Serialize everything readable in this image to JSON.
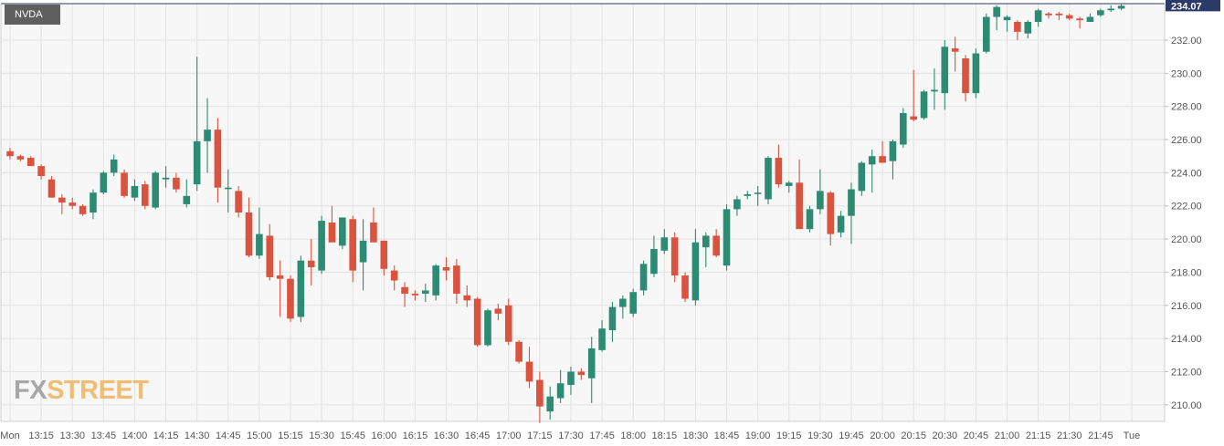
{
  "symbol": "NVDA",
  "watermark": {
    "part1": "FX",
    "part2": "STREET"
  },
  "colors": {
    "up": "#2e8b73",
    "down": "#d9533f",
    "plot_bg": "#f7f7f7",
    "grid": "#e2e2e2",
    "price_tag_bg": "#2b3a66",
    "axis_text": "#555555"
  },
  "chart_data": {
    "type": "candlestick",
    "title": "",
    "ylim": [
      209.0,
      234.2
    ],
    "yticks": [
      210,
      212,
      214,
      216,
      218,
      220,
      222,
      224,
      226,
      228,
      230,
      232
    ],
    "ytick_labels": [
      "210.00",
      "212.00",
      "214.00",
      "216.00",
      "218.00",
      "220.00",
      "222.00",
      "224.00",
      "226.00",
      "228.00",
      "230.00",
      "232.00"
    ],
    "last_price": "234.07",
    "last_price_value": 234.07,
    "x_labels": [
      "Mon",
      "13:15",
      "13:30",
      "13:45",
      "14:00",
      "14:15",
      "14:30",
      "14:45",
      "15:00",
      "15:15",
      "15:30",
      "15:45",
      "16:00",
      "16:15",
      "16:30",
      "16:45",
      "17:00",
      "17:15",
      "17:30",
      "17:45",
      "18:00",
      "18:15",
      "18:30",
      "18:45",
      "19:00",
      "19:15",
      "19:30",
      "19:45",
      "20:00",
      "20:15",
      "20:30",
      "20:45",
      "21:00",
      "21:15",
      "21:30",
      "21:45",
      "Tue"
    ],
    "interval": "5 minutes",
    "candles": [
      {
        "time": "13:00",
        "o": 225.3,
        "h": 225.5,
        "l": 224.8,
        "c": 225.0
      },
      {
        "time": "13:05",
        "o": 225.0,
        "h": 225.1,
        "l": 224.7,
        "c": 224.8
      },
      {
        "time": "13:10",
        "o": 224.9,
        "h": 225.0,
        "l": 224.4,
        "c": 224.4
      },
      {
        "time": "13:15",
        "o": 224.4,
        "h": 224.5,
        "l": 223.6,
        "c": 223.8
      },
      {
        "time": "13:20",
        "o": 223.6,
        "h": 223.8,
        "l": 222.5,
        "c": 222.5
      },
      {
        "time": "13:25",
        "o": 222.5,
        "h": 222.7,
        "l": 221.5,
        "c": 222.2
      },
      {
        "time": "13:30",
        "o": 222.2,
        "h": 222.5,
        "l": 221.8,
        "c": 222.0
      },
      {
        "time": "13:35",
        "o": 222.0,
        "h": 222.1,
        "l": 221.4,
        "c": 221.5
      },
      {
        "time": "13:40",
        "o": 221.6,
        "h": 223.0,
        "l": 221.2,
        "c": 222.8
      },
      {
        "time": "13:45",
        "o": 222.8,
        "h": 224.1,
        "l": 222.7,
        "c": 224.0
      },
      {
        "time": "13:50",
        "o": 224.0,
        "h": 225.1,
        "l": 223.8,
        "c": 224.8
      },
      {
        "time": "13:55",
        "o": 224.0,
        "h": 224.2,
        "l": 222.5,
        "c": 222.6
      },
      {
        "time": "14:00",
        "o": 222.5,
        "h": 223.6,
        "l": 222.3,
        "c": 223.2
      },
      {
        "time": "14:05",
        "o": 223.3,
        "h": 223.5,
        "l": 221.8,
        "c": 222.0
      },
      {
        "time": "14:10",
        "o": 221.9,
        "h": 224.1,
        "l": 221.8,
        "c": 224.0
      },
      {
        "time": "14:15",
        "o": 223.6,
        "h": 224.4,
        "l": 223.1,
        "c": 223.7
      },
      {
        "time": "14:20",
        "o": 223.7,
        "h": 224.0,
        "l": 222.8,
        "c": 223.0
      },
      {
        "time": "14:25",
        "o": 222.1,
        "h": 223.6,
        "l": 221.9,
        "c": 222.6
      },
      {
        "time": "14:30",
        "o": 223.3,
        "h": 231.0,
        "l": 222.9,
        "c": 225.9
      },
      {
        "time": "14:35",
        "o": 225.9,
        "h": 228.5,
        "l": 224.0,
        "c": 226.6
      },
      {
        "time": "14:40",
        "o": 226.6,
        "h": 227.3,
        "l": 222.2,
        "c": 223.1
      },
      {
        "time": "14:45",
        "o": 223.1,
        "h": 224.2,
        "l": 221.6,
        "c": 223.1
      },
      {
        "time": "14:50",
        "o": 222.9,
        "h": 223.2,
        "l": 221.3,
        "c": 221.6
      },
      {
        "time": "14:55",
        "o": 221.6,
        "h": 222.5,
        "l": 218.9,
        "c": 219.0
      },
      {
        "time": "15:00",
        "o": 219.0,
        "h": 221.9,
        "l": 218.8,
        "c": 220.3
      },
      {
        "time": "15:05",
        "o": 220.2,
        "h": 220.9,
        "l": 217.5,
        "c": 217.7
      },
      {
        "time": "15:10",
        "o": 217.8,
        "h": 218.7,
        "l": 215.3,
        "c": 217.6
      },
      {
        "time": "15:15",
        "o": 217.6,
        "h": 217.8,
        "l": 215.0,
        "c": 215.2
      },
      {
        "time": "15:20",
        "o": 215.3,
        "h": 219.0,
        "l": 215.0,
        "c": 218.7
      },
      {
        "time": "15:25",
        "o": 218.7,
        "h": 220.0,
        "l": 217.2,
        "c": 218.3
      },
      {
        "time": "15:30",
        "o": 218.1,
        "h": 221.4,
        "l": 217.9,
        "c": 221.1
      },
      {
        "time": "15:35",
        "o": 221.0,
        "h": 222.0,
        "l": 219.8,
        "c": 219.8
      },
      {
        "time": "15:40",
        "o": 219.6,
        "h": 221.3,
        "l": 219.4,
        "c": 221.3
      },
      {
        "time": "15:45",
        "o": 221.2,
        "h": 221.4,
        "l": 217.4,
        "c": 218.1
      },
      {
        "time": "15:50",
        "o": 218.6,
        "h": 221.2,
        "l": 216.9,
        "c": 219.9
      },
      {
        "time": "15:55",
        "o": 221.0,
        "h": 221.9,
        "l": 219.8,
        "c": 219.8
      },
      {
        "time": "16:00",
        "o": 219.9,
        "h": 219.9,
        "l": 217.8,
        "c": 218.2
      },
      {
        "time": "16:05",
        "o": 218.1,
        "h": 218.4,
        "l": 216.9,
        "c": 217.5
      },
      {
        "time": "16:10",
        "o": 217.1,
        "h": 217.4,
        "l": 215.9,
        "c": 216.7
      },
      {
        "time": "16:15",
        "o": 216.7,
        "h": 216.9,
        "l": 216.3,
        "c": 216.6
      },
      {
        "time": "16:20",
        "o": 216.7,
        "h": 217.3,
        "l": 216.2,
        "c": 216.9
      },
      {
        "time": "16:25",
        "o": 216.6,
        "h": 218.5,
        "l": 216.3,
        "c": 218.4
      },
      {
        "time": "16:30",
        "o": 218.3,
        "h": 218.9,
        "l": 217.5,
        "c": 218.1
      },
      {
        "time": "16:35",
        "o": 218.4,
        "h": 218.8,
        "l": 216.1,
        "c": 216.7
      },
      {
        "time": "16:40",
        "o": 216.6,
        "h": 217.2,
        "l": 215.9,
        "c": 216.3
      },
      {
        "time": "16:45",
        "o": 216.4,
        "h": 216.5,
        "l": 213.5,
        "c": 213.6
      },
      {
        "time": "16:50",
        "o": 213.6,
        "h": 215.8,
        "l": 213.5,
        "c": 215.7
      },
      {
        "time": "16:55",
        "o": 215.8,
        "h": 216.1,
        "l": 215.1,
        "c": 215.5
      },
      {
        "time": "17:00",
        "o": 216.0,
        "h": 216.4,
        "l": 213.6,
        "c": 213.8
      },
      {
        "time": "17:05",
        "o": 213.8,
        "h": 213.9,
        "l": 212.5,
        "c": 212.6
      },
      {
        "time": "17:10",
        "o": 212.6,
        "h": 213.5,
        "l": 211.0,
        "c": 211.4
      },
      {
        "time": "17:15",
        "o": 211.5,
        "h": 212.0,
        "l": 208.9,
        "c": 209.9
      },
      {
        "time": "17:20",
        "o": 209.6,
        "h": 211.1,
        "l": 209.1,
        "c": 210.5
      },
      {
        "time": "17:25",
        "o": 210.4,
        "h": 212.1,
        "l": 210.1,
        "c": 211.3
      },
      {
        "time": "17:30",
        "o": 211.2,
        "h": 212.3,
        "l": 210.6,
        "c": 212.0
      },
      {
        "time": "17:35",
        "o": 212.0,
        "h": 212.2,
        "l": 211.5,
        "c": 211.8
      },
      {
        "time": "17:40",
        "o": 211.6,
        "h": 214.1,
        "l": 210.1,
        "c": 213.4
      },
      {
        "time": "17:45",
        "o": 213.3,
        "h": 215.1,
        "l": 213.2,
        "c": 214.6
      },
      {
        "time": "17:50",
        "o": 214.5,
        "h": 216.2,
        "l": 213.8,
        "c": 215.9
      },
      {
        "time": "17:55",
        "o": 215.9,
        "h": 216.6,
        "l": 215.2,
        "c": 216.4
      },
      {
        "time": "18:00",
        "o": 215.5,
        "h": 217.0,
        "l": 215.3,
        "c": 216.8
      },
      {
        "time": "18:05",
        "o": 216.9,
        "h": 218.7,
        "l": 216.6,
        "c": 218.5
      },
      {
        "time": "18:10",
        "o": 217.9,
        "h": 220.2,
        "l": 217.7,
        "c": 219.4
      },
      {
        "time": "18:15",
        "o": 219.3,
        "h": 220.6,
        "l": 219.1,
        "c": 220.1
      },
      {
        "time": "18:20",
        "o": 220.1,
        "h": 220.4,
        "l": 217.4,
        "c": 217.8
      },
      {
        "time": "18:25",
        "o": 217.8,
        "h": 218.0,
        "l": 216.2,
        "c": 216.4
      },
      {
        "time": "18:30",
        "o": 216.3,
        "h": 220.6,
        "l": 216.0,
        "c": 219.8
      },
      {
        "time": "18:35",
        "o": 219.5,
        "h": 220.4,
        "l": 218.3,
        "c": 220.2
      },
      {
        "time": "18:40",
        "o": 220.2,
        "h": 220.6,
        "l": 218.9,
        "c": 219.0
      },
      {
        "time": "18:45",
        "o": 218.4,
        "h": 222.1,
        "l": 218.1,
        "c": 221.8
      },
      {
        "time": "18:50",
        "o": 221.8,
        "h": 222.6,
        "l": 221.4,
        "c": 222.4
      },
      {
        "time": "18:55",
        "o": 222.6,
        "h": 222.9,
        "l": 222.4,
        "c": 222.7
      },
      {
        "time": "19:00",
        "o": 222.8,
        "h": 223.2,
        "l": 222.0,
        "c": 222.8
      },
      {
        "time": "19:05",
        "o": 222.4,
        "h": 225.0,
        "l": 222.1,
        "c": 224.9
      },
      {
        "time": "19:10",
        "o": 224.9,
        "h": 225.7,
        "l": 223.1,
        "c": 223.3
      },
      {
        "time": "19:15",
        "o": 223.2,
        "h": 223.5,
        "l": 222.8,
        "c": 223.4
      },
      {
        "time": "19:20",
        "o": 223.4,
        "h": 224.8,
        "l": 220.6,
        "c": 220.6
      },
      {
        "time": "19:25",
        "o": 220.6,
        "h": 222.0,
        "l": 220.4,
        "c": 221.8
      },
      {
        "time": "19:30",
        "o": 221.8,
        "h": 224.2,
        "l": 221.5,
        "c": 222.9
      },
      {
        "time": "19:35",
        "o": 222.8,
        "h": 222.9,
        "l": 219.6,
        "c": 220.3
      },
      {
        "time": "19:40",
        "o": 220.4,
        "h": 221.7,
        "l": 220.1,
        "c": 221.4
      },
      {
        "time": "19:45",
        "o": 221.4,
        "h": 223.4,
        "l": 219.7,
        "c": 223.0
      },
      {
        "time": "19:50",
        "o": 222.9,
        "h": 224.7,
        "l": 222.6,
        "c": 224.6
      },
      {
        "time": "19:55",
        "o": 224.5,
        "h": 225.4,
        "l": 222.8,
        "c": 225.0
      },
      {
        "time": "20:00",
        "o": 225.0,
        "h": 225.9,
        "l": 224.6,
        "c": 224.6
      },
      {
        "time": "20:05",
        "o": 224.7,
        "h": 226.0,
        "l": 223.6,
        "c": 225.9
      },
      {
        "time": "20:10",
        "o": 225.7,
        "h": 227.9,
        "l": 225.5,
        "c": 227.6
      },
      {
        "time": "20:15",
        "o": 227.4,
        "h": 230.2,
        "l": 227.1,
        "c": 227.2
      },
      {
        "time": "20:20",
        "o": 227.3,
        "h": 229.0,
        "l": 227.2,
        "c": 228.9
      },
      {
        "time": "20:25",
        "o": 228.9,
        "h": 230.3,
        "l": 227.8,
        "c": 229.0
      },
      {
        "time": "20:30",
        "o": 228.8,
        "h": 232.0,
        "l": 227.8,
        "c": 231.6
      },
      {
        "time": "20:35",
        "o": 231.5,
        "h": 232.2,
        "l": 230.1,
        "c": 231.3
      },
      {
        "time": "20:40",
        "o": 230.9,
        "h": 231.1,
        "l": 228.3,
        "c": 228.8
      },
      {
        "time": "20:45",
        "o": 228.8,
        "h": 231.5,
        "l": 228.5,
        "c": 231.2
      },
      {
        "time": "20:50",
        "o": 231.3,
        "h": 233.6,
        "l": 231.2,
        "c": 233.4
      },
      {
        "time": "20:55",
        "o": 233.4,
        "h": 234.1,
        "l": 232.6,
        "c": 234.0
      },
      {
        "time": "21:00",
        "o": 233.2,
        "h": 233.5,
        "l": 232.5,
        "c": 233.4
      },
      {
        "time": "21:05",
        "o": 233.1,
        "h": 233.2,
        "l": 232.0,
        "c": 232.5
      },
      {
        "time": "21:10",
        "o": 232.4,
        "h": 233.2,
        "l": 232.1,
        "c": 233.1
      },
      {
        "time": "21:15",
        "o": 233.1,
        "h": 233.9,
        "l": 232.8,
        "c": 233.8
      },
      {
        "time": "21:20",
        "o": 233.6,
        "h": 233.7,
        "l": 233.3,
        "c": 233.5
      },
      {
        "time": "21:25",
        "o": 233.6,
        "h": 233.7,
        "l": 233.2,
        "c": 233.5
      },
      {
        "time": "21:30",
        "o": 233.5,
        "h": 233.6,
        "l": 233.2,
        "c": 233.3
      },
      {
        "time": "21:35",
        "o": 233.3,
        "h": 233.4,
        "l": 232.7,
        "c": 233.2
      },
      {
        "time": "21:40",
        "o": 233.1,
        "h": 233.6,
        "l": 233.1,
        "c": 233.4
      },
      {
        "time": "21:45",
        "o": 233.5,
        "h": 233.9,
        "l": 233.4,
        "c": 233.8
      },
      {
        "time": "21:50",
        "o": 233.8,
        "h": 234.1,
        "l": 233.7,
        "c": 233.9
      },
      {
        "time": "21:55",
        "o": 233.9,
        "h": 234.2,
        "l": 233.8,
        "c": 234.07
      }
    ]
  }
}
